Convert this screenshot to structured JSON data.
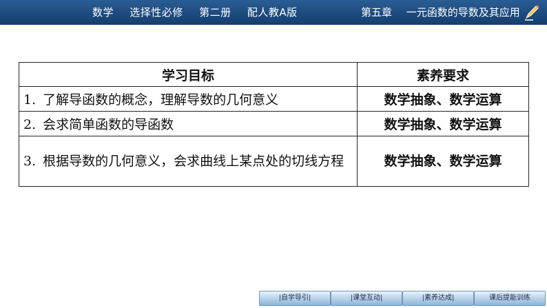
{
  "header": {
    "left_items": [
      "数学",
      "选择性必修",
      "第二册",
      "配人教A版"
    ],
    "chapter": "第五章",
    "chapter_title": "一元函数的导数及其应用",
    "background": "#1d4a7e"
  },
  "table": {
    "headers": [
      "学习目标",
      "素养要求"
    ],
    "rows": [
      {
        "num": "1.",
        "goal": "了解导函数的概念，理解导数的几何意义",
        "requirement": "数学抽象、数学运算"
      },
      {
        "num": "2.",
        "goal": "会求简单函数的导函数",
        "requirement": "数学抽象、数学运算"
      },
      {
        "num": "3.",
        "goal": "根据导数的几何意义，会求曲线上某点处的切线方程",
        "requirement": "数学抽象、数学运算"
      }
    ]
  },
  "nav": {
    "buttons": [
      "|自学导引|",
      "|课堂互动|",
      "|素养达成|",
      "课后提能训练"
    ]
  }
}
